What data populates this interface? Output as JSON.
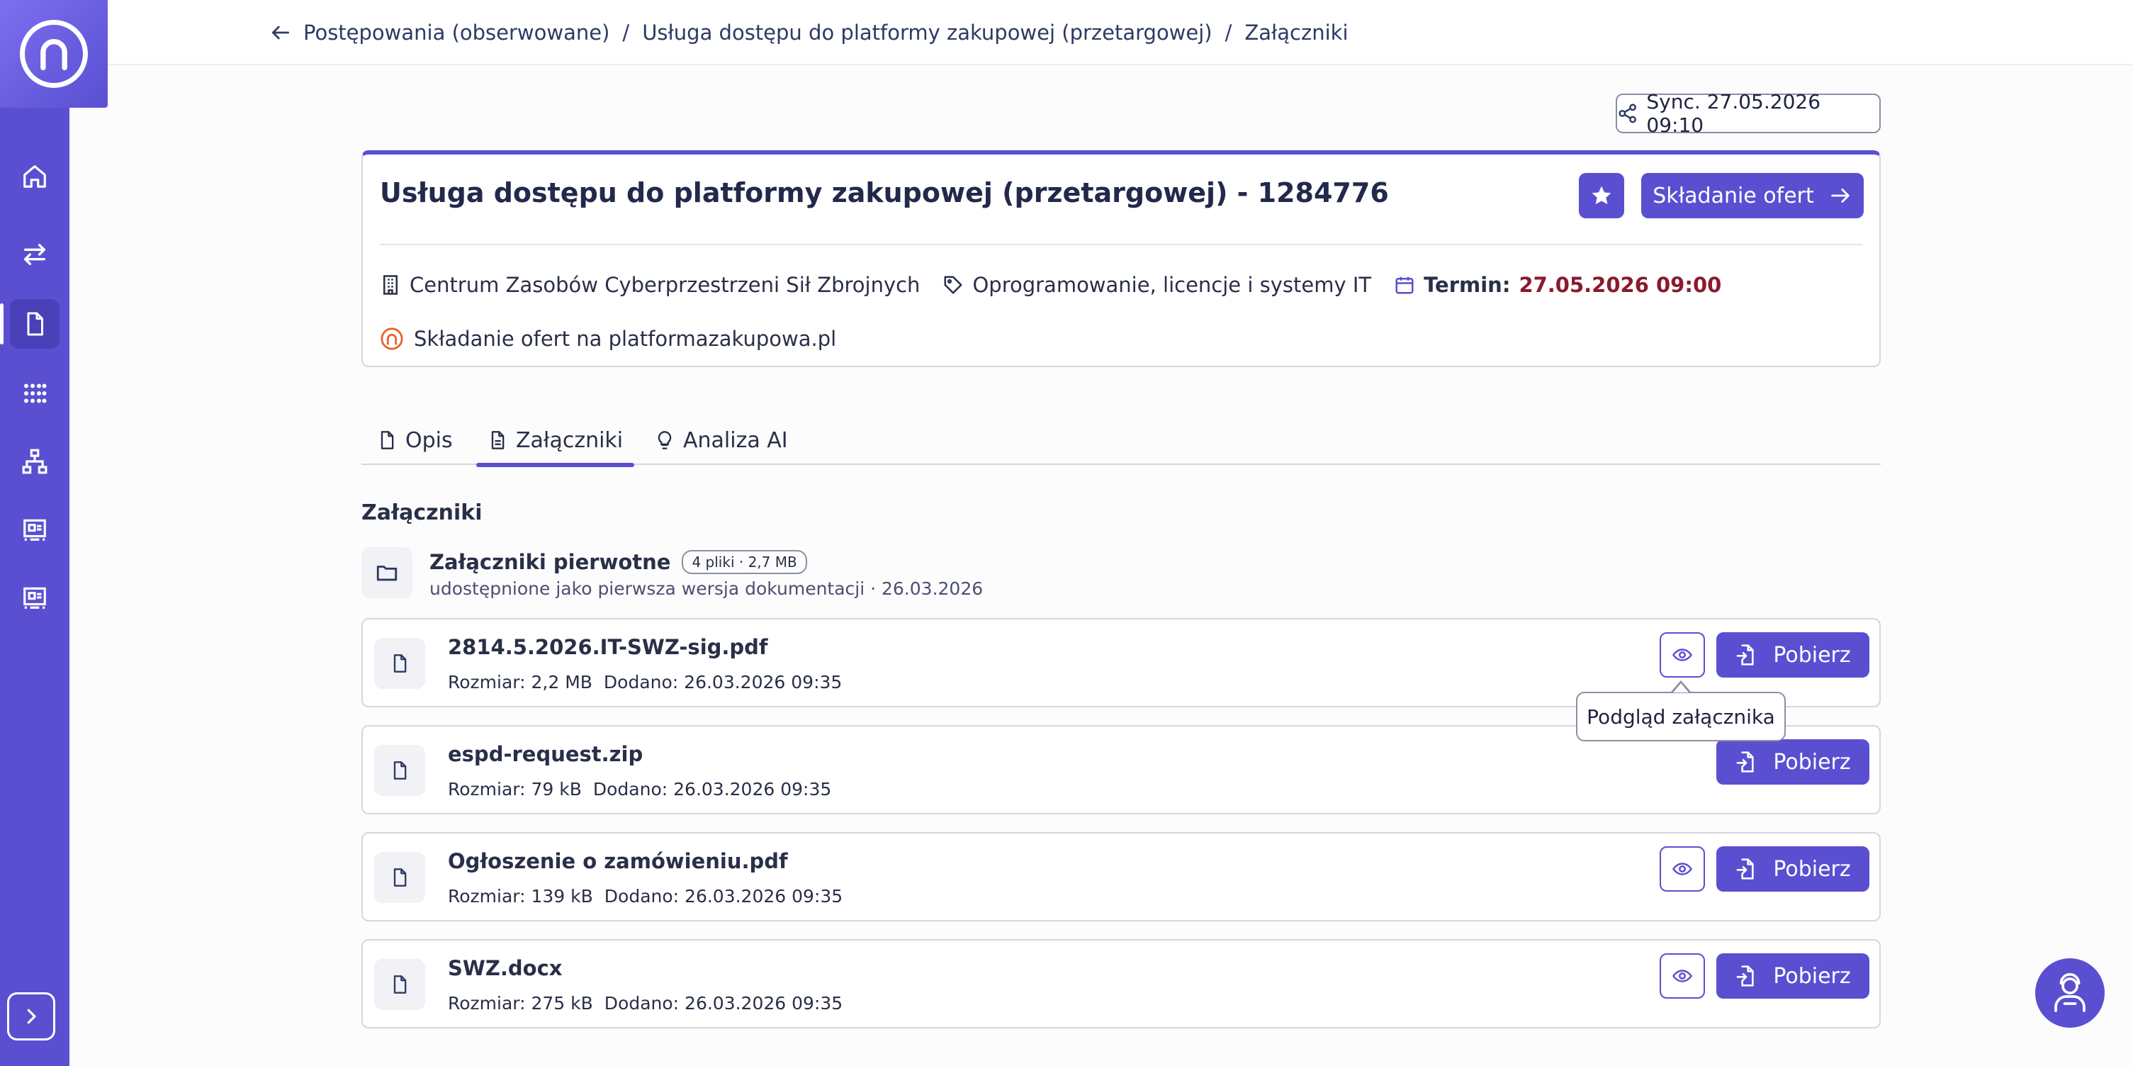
{
  "breadcrumb": {
    "items": [
      {
        "label": "Postępowania (obserwowane)"
      },
      {
        "label": "Usługa dostępu do platformy zakupowej (przetargowej)"
      },
      {
        "label": "Załączniki"
      }
    ],
    "separator": "/"
  },
  "sync": {
    "label": "Sync. 27.05.2026 09:10"
  },
  "tender": {
    "title": "Usługa dostępu do platformy zakupowej (przetargowej) - 1284776",
    "offer_button": "Składanie ofert",
    "organization": "Centrum Zasobów Cyberprzestrzeni Sił Zbrojnych",
    "category": "Oprogramowanie, licencje i systemy IT",
    "deadline_label": "Termin:",
    "deadline_value": "27.05.2026 09:00",
    "platform": "Składanie ofert na platformazakupowa.pl"
  },
  "tabs": [
    {
      "label": "Opis",
      "icon": "file-icon",
      "active": false
    },
    {
      "label": "Załączniki",
      "icon": "document-lines-icon",
      "active": true
    },
    {
      "label": "Analiza AI",
      "icon": "lightbulb-icon",
      "active": false
    }
  ],
  "attachments": {
    "section_title": "Załączniki",
    "folder": {
      "title": "Załączniki pierwotne",
      "badge": "4 pliki · 2,7 MB",
      "subtitle": "udostępnione jako pierwsza wersja dokumentacji · 26.03.2026"
    },
    "files": [
      {
        "name": "2814.5.2026.IT-SWZ-sig.pdf",
        "size": "Rozmiar: 2,2 MB",
        "added": "Dodano: 26.03.2026 09:35",
        "preview": true
      },
      {
        "name": "espd-request.zip",
        "size": "Rozmiar: 79 kB",
        "added": "Dodano: 26.03.2026 09:35",
        "preview": false
      },
      {
        "name": "Ogłoszenie o zamówieniu.pdf",
        "size": "Rozmiar: 139 kB",
        "added": "Dodano: 26.03.2026 09:35",
        "preview": true
      },
      {
        "name": "SWZ.docx",
        "size": "Rozmiar: 275 kB",
        "added": "Dodano: 26.03.2026 09:35",
        "preview": true
      }
    ],
    "download_label": "Pobierz",
    "tooltip": "Podgląd załącznika"
  },
  "colors": {
    "accent": "#5a4fd1",
    "deadline": "#8a1a2e",
    "platform_logo": "#e8622c"
  }
}
